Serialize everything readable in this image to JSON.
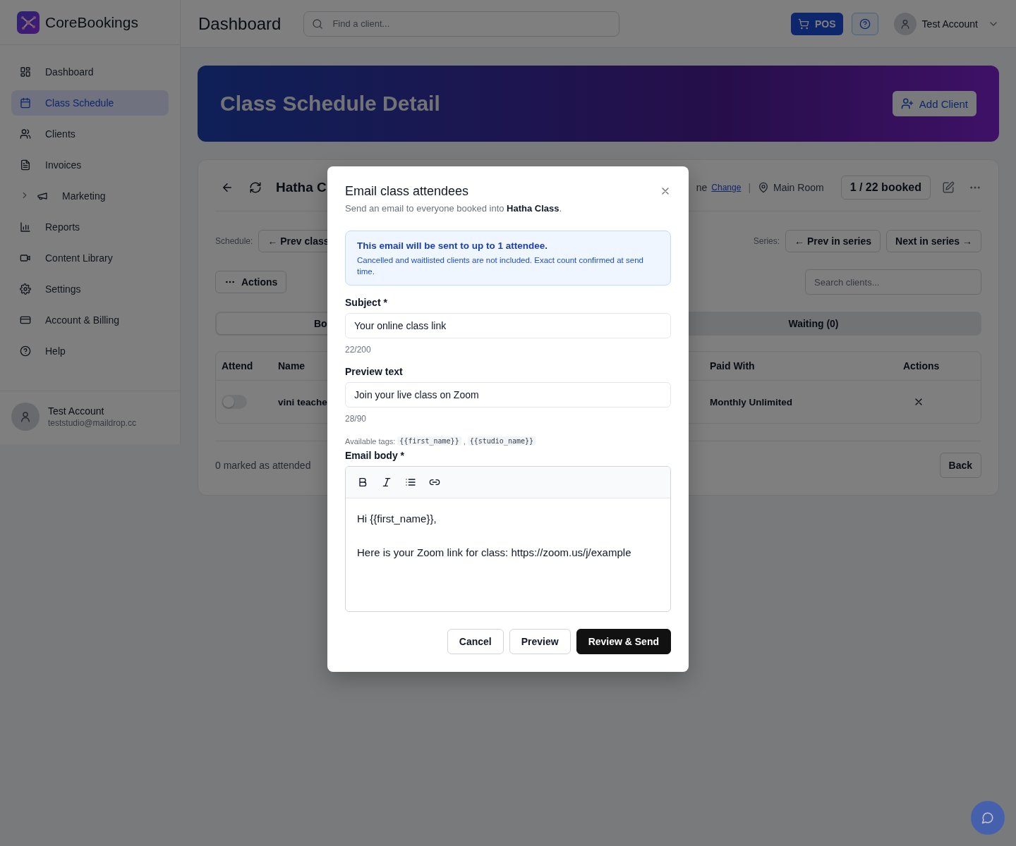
{
  "app": {
    "name": "CoreBookings"
  },
  "sidebar": {
    "items": [
      {
        "label": "Dashboard",
        "kind": "link",
        "selected": false
      },
      {
        "label": "Class Schedule",
        "kind": "link",
        "selected": true
      },
      {
        "label": "Clients",
        "kind": "link",
        "selected": false
      },
      {
        "label": "Invoices",
        "kind": "link",
        "selected": false
      },
      {
        "label": "Marketing",
        "kind": "group",
        "selected": false
      },
      {
        "label": "Reports",
        "kind": "link",
        "selected": false
      },
      {
        "label": "Content Library",
        "kind": "link",
        "selected": false
      },
      {
        "label": "Settings",
        "kind": "link",
        "selected": false
      },
      {
        "label": "Account & Billing",
        "kind": "link",
        "selected": false
      },
      {
        "label": "Help",
        "kind": "link",
        "selected": false
      }
    ],
    "user": {
      "name": "Test Account",
      "email": "teststudio@maildrop.cc"
    }
  },
  "header": {
    "title": "Dashboard",
    "search": {
      "placeholder": "Find a client..."
    },
    "pos_button": "POS",
    "account": "Test Account"
  },
  "banner": {
    "title": "Class Schedule Detail",
    "button": "Add Client"
  },
  "class_card": {
    "title": "Hatha C",
    "time_tail": "ne",
    "change_link": "Change",
    "separator": "|",
    "room": "Main Room",
    "booked": "1 / 22 booked",
    "schedule_label": "Schedule:",
    "prev_class": "← Prev class",
    "series_label": "Series:",
    "prev_series": "← Prev in series",
    "next_series": "Next in series →",
    "actions_button": "Actions",
    "search": {
      "placeholder": "Search clients..."
    },
    "tabs": [
      {
        "label": "Bo",
        "selected": true
      },
      {
        "label": "Waiting (0)",
        "selected": false
      }
    ],
    "table": {
      "columns": [
        "Attend",
        "Name",
        "Paid With",
        "Actions"
      ],
      "rows": [
        {
          "attend": false,
          "name": "vini teache",
          "paid_with": "Monthly Unlimited"
        }
      ]
    },
    "footer": "0 marked as attended",
    "back_button": "Back"
  },
  "modal": {
    "title": "Email class attendees",
    "subtitle": "Send an email to everyone booked into **Hatha Class**.",
    "notice": {
      "title": "This email will be sent to up to 1 attendee.",
      "body": "Cancelled and waitlisted clients are not included. Exact count confirmed at send time."
    },
    "subject": {
      "label": "Subject *",
      "value": "Your online class link",
      "counter": "22/200"
    },
    "preview_text": {
      "label": "Preview text",
      "value": "Join your live class on Zoom",
      "counter": "28/90"
    },
    "tags": {
      "label": "Available tags:",
      "items": [
        "{{first_name}}",
        "{{studio_name}}"
      ],
      "separator": ","
    },
    "body": {
      "label": "Email body *",
      "toolbar": [
        {
          "kind": "bold"
        },
        {
          "kind": "italic"
        },
        {
          "kind": "list"
        },
        {
          "kind": "link"
        }
      ],
      "paragraphs": [
        "Hi {{first_name}},",
        "Here is your Zoom link for class: https://zoom.us/j/example"
      ]
    },
    "buttons": [
      {
        "label": "Cancel",
        "kind": "secondary"
      },
      {
        "label": "Preview",
        "kind": "secondary"
      },
      {
        "label": "Review & Send",
        "kind": "primary"
      }
    ]
  }
}
